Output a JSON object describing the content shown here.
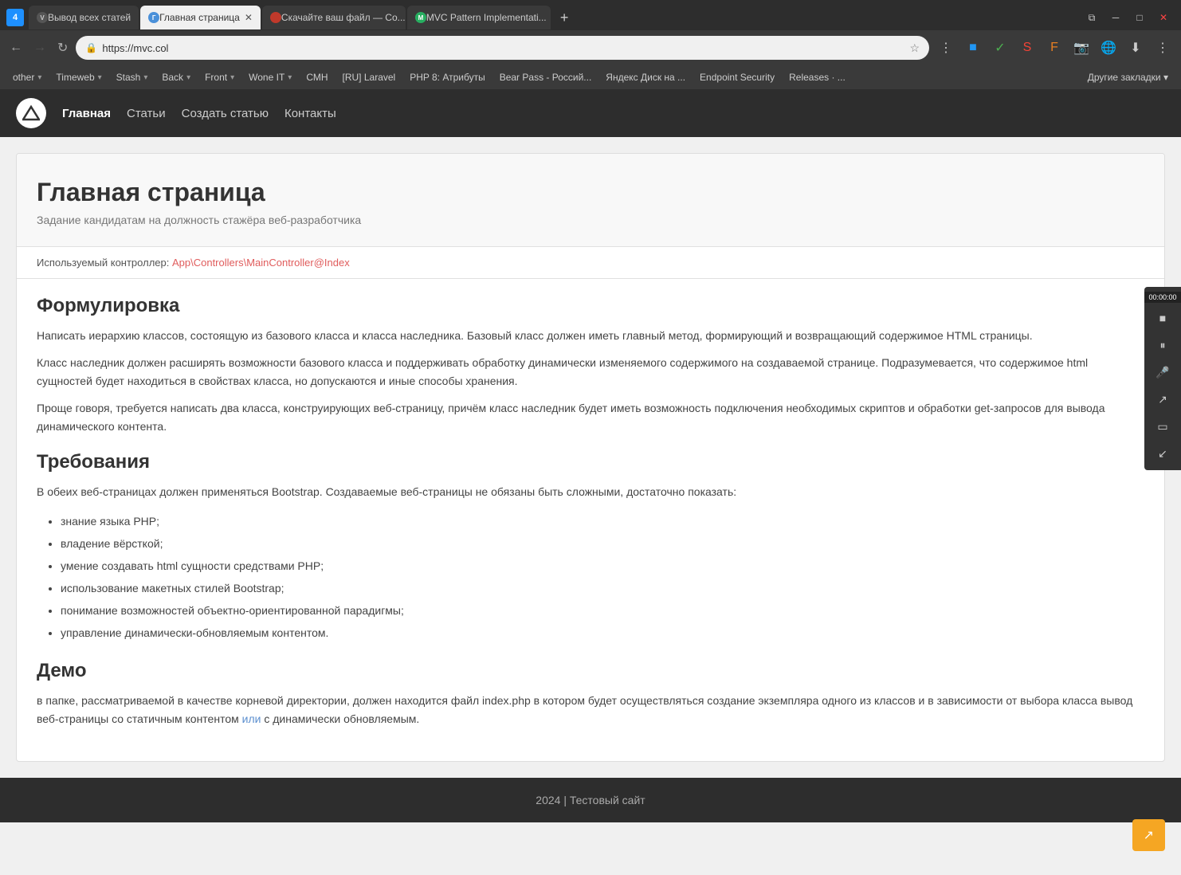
{
  "browser": {
    "tabs": [
      {
        "id": "vyvod",
        "label": "Вывод всех статей",
        "active": false,
        "favicon_type": "dark"
      },
      {
        "id": "main",
        "label": "Главная страница",
        "active": true,
        "favicon_type": "blue"
      },
      {
        "id": "skachat",
        "label": "Скачайте ваш файл — Co...",
        "active": false,
        "favicon_type": "red"
      },
      {
        "id": "mvc",
        "label": "MVC Pattern Implementati...",
        "active": false,
        "favicon_type": "green"
      }
    ],
    "address": "https://mvc.col",
    "window_controls": [
      "restore",
      "minimize",
      "maximize",
      "close"
    ]
  },
  "bookmarks": [
    {
      "label": "other",
      "has_dropdown": true
    },
    {
      "label": "Timeweb",
      "has_dropdown": true
    },
    {
      "label": "Stash",
      "has_dropdown": true
    },
    {
      "label": "Back",
      "has_dropdown": true
    },
    {
      "label": "Front",
      "has_dropdown": true
    },
    {
      "label": "Wone IT",
      "has_dropdown": true
    },
    {
      "label": "СМН"
    },
    {
      "label": "[RU] Laravel"
    },
    {
      "label": "PHP 8: Атрибуты"
    },
    {
      "label": "Bear Pass - Россий..."
    },
    {
      "label": "Яндекс Диск на ..."
    },
    {
      "label": "Endpoint Security"
    },
    {
      "label": "Releases · ..."
    }
  ],
  "bookmarks_more": "Другие закладки",
  "nav": {
    "logo_text": "∧",
    "links": [
      {
        "label": "Главная",
        "active": true
      },
      {
        "label": "Статьи",
        "active": false
      },
      {
        "label": "Создать статью",
        "active": false
      },
      {
        "label": "Контакты",
        "active": false
      }
    ]
  },
  "hero": {
    "title": "Главная страница",
    "subtitle": "Задание кандидатам на должность стажёра веб-разработчика"
  },
  "controller_info": {
    "prefix": "Используемый контроллер:",
    "link_text": "App\\Controllers\\MainController@Index"
  },
  "sections": [
    {
      "title": "Формулировка",
      "paragraphs": [
        "Написать иерархию классов, состоящую из базового класса и класса наследника. Базовый класс должен иметь главный метод, формирующий и возвращающий содержимое HTML страницы.",
        "Класс наследник должен расширять возможности базового класса и поддерживать обработку динамически изменяемого содержимого на создаваемой странице. Подразумевается, что содержимое html сущностей будет находиться в свойствах класса, но допускаются и иные способы хранения.",
        "Проще говоря, требуется написать два класса, конструирующих веб-страницу, причём класс наследник будет иметь возможность подключения необходимых скриптов и обработки get-запросов для вывода динамического контента."
      ],
      "has_list": false
    },
    {
      "title": "Требования",
      "intro": "В обеих веб-страницах должен применяться Bootstrap. Создаваемые веб-страницы не обязаны быть сложными, достаточно показать:",
      "list_items": [
        "знание языка PHP;",
        "владение вёрсткой;",
        "умение создавать html сущности средствами PHP;",
        "использование макетных стилей Bootstrap;",
        "понимание возможностей объектно-ориентированной парадигмы;",
        "управление динамически-обновляемым контентом."
      ],
      "has_list": true
    },
    {
      "title": "Демо",
      "paragraphs": [
        "в папке, рассматриваемой в качестве корневой директории, должен находится файл index.php в котором будет осуществляться создание экземпляра одного из классов и в зависимости от выбора класса вывод веб-страницы со статичным контентом или с динамически обновляемым."
      ],
      "link1_text": "или",
      "has_list": false
    }
  ],
  "footer": {
    "text": "2024 | Тестовый сайт"
  },
  "side_widget": {
    "timer": "00:00:00",
    "buttons": [
      "stop",
      "pause",
      "mic-off",
      "arrow-up",
      "screen",
      "arrow-down"
    ]
  },
  "fab": {
    "icon": "↗"
  }
}
